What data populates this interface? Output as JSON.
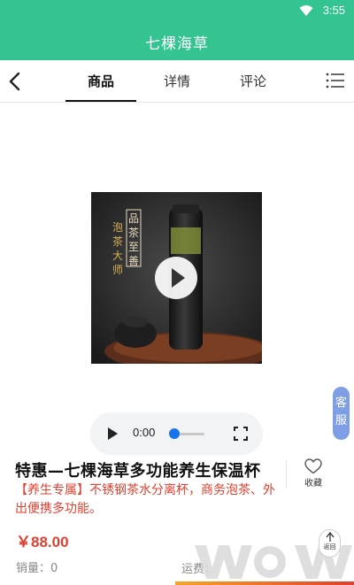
{
  "status_bar": {
    "time": "3:55",
    "wifi_icon": "wifi-icon"
  },
  "app_bar": {
    "title": "七棵海草",
    "background": "#33c491"
  },
  "tabs": {
    "back_icon": "chevron-left-icon",
    "items": [
      {
        "label": "商品",
        "active": true
      },
      {
        "label": "详情",
        "active": false
      },
      {
        "label": "评论",
        "active": false
      }
    ],
    "menu_icon": "list-menu-icon"
  },
  "media": {
    "play_icon": "play-icon",
    "audio_player": {
      "current_time": "0:00",
      "progress": 0
    }
  },
  "customer_service": {
    "line1": "客",
    "line2": "服",
    "color": "#7e9fe6"
  },
  "product": {
    "title": "特惠—七棵海草多功能养生保温杯",
    "description": "【养生专属】不锈钢茶水分离杯，商务泡茶、外出便携多功能。",
    "price": "￥88.00",
    "sales": "销量：0",
    "shipping": "运费：",
    "favorite_label": "收藏",
    "accent_color": "#e0402f"
  },
  "back_to_top": {
    "label": "返回"
  }
}
